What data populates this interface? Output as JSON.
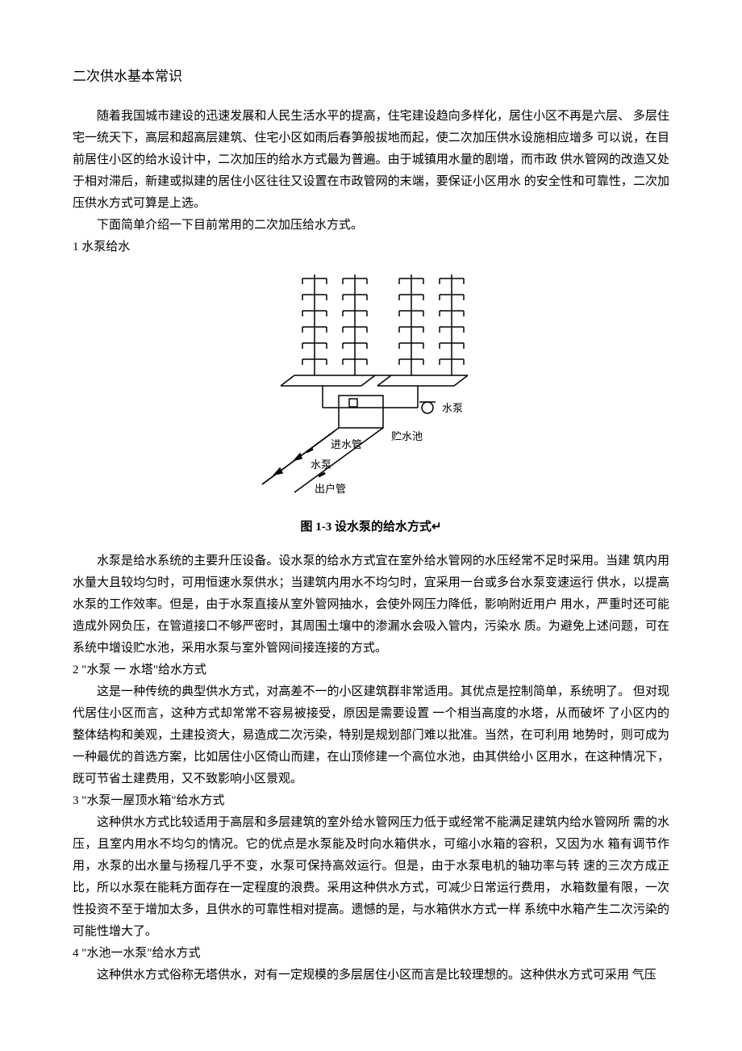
{
  "title": "二次供水基本常识",
  "intro_para1": "随着我国城市建设的迅速发展和人民生活水平的提高，住宅建设趋向多样化，居住小区不再是六层、 多层住宅一统天下，高层和超高层建筑、住宅小区如雨后春笋般拔地而起，使二次加压供水设施相应增多  可以说，在目前居住小区的给水设计中，二次加压的给水方式最为普遍。由于城镇用水量的剧增，而市政  供水管网的改造又处于相对滞后，新建或拟建的居住小区往往又设置在市政管网的末端，要保证小区用水  的安全性和可靠性，二次加压供水方式可算是上选。",
  "intro_para2": "下面简单介绍一下目前常用的二次加压给水方式。",
  "section1": {
    "heading": "1  水泵给水",
    "figure_caption": "图 1-3   设水泵的给水方式↵",
    "figure_labels": {
      "inlet_pipe": "进水管",
      "pump_label": "水泵",
      "drain_pool": "贮水池",
      "outlet_pipe": "出户管",
      "pump_symbol": "水泵"
    },
    "body": "水泵是给水系统的主要升压设备。设水泵的给水方式宜在室外给水管网的水压经常不足时采用。当建  筑内用水量大且较均匀时，可用恒速水泵供水；当建筑内用水不均匀时，宜采用一台或多台水泵变速运行  供水，以提高水泵的工作效率。但是，由于水泵直接从室外管网抽水，会使外网压力降低，影响附近用户  用水，严重时还可能造成外网负压，在管道接口不够严密时，其周围土壤中的渗漏水会吸入管内，污染水  质。为避免上述问题，可在系统中增设贮水池，采用水泵与室外管网间接连接的方式。"
  },
  "section2": {
    "heading": "2 \"水泵  一  水塔\"给水方式",
    "body": "这是一种传统的典型供水方式，对高差不一的小区建筑群非常适用。其优点是控制简单，系统明了。  但对现代居住小区而言，这种方式却常常不容易被接受，原因是需要设置 一个相当高度的水塔，从而破坏  了小区内的整体结构和美观，土建投资大，易造成二次污染，特别是规划部门难以批准。当然，在可利用  地势时，则可成为一种最优的首选方案，比如居住小区倚山而建，在山顶修建一个高位水池，由其供给小  区用水，在这种情况下，既可节省土建费用，又不致影响小区景观。"
  },
  "section3": {
    "heading": "3  \"水泵一屋顶水箱\"给水方式",
    "body": "这种供水方式比较适用于高层和多层建筑的室外给水管网压力低于或经常不能满足建筑内给水管网所  需的水压，且室内用水不均匀的情况。它的优点是水泵能及时向水箱供水，可缩小水箱的容积，又因为水  箱有调节作用，水泵的出水量与扬程几乎不变，水泵可保持高效运行。但是，由于水泵电机的轴功率与转  速的三次方成正比，所以水泵在能耗方面存在一定程度的浪费。采用这种供水方式，可减少日常运行费用，  水箱数量有限，一次性投资不至于增加太多，且供水的可靠性相对提高。遗憾的是，与水箱供水方式一样  系统中水箱产生二次污染的可能性增大了。"
  },
  "section4": {
    "heading": "4  \"水池一水泵\"给水方式",
    "body": "这种供水方式俗称无塔供水，对有一定规模的多层居住小区而言是比较理想的。这种供水方式可采用  气压"
  }
}
